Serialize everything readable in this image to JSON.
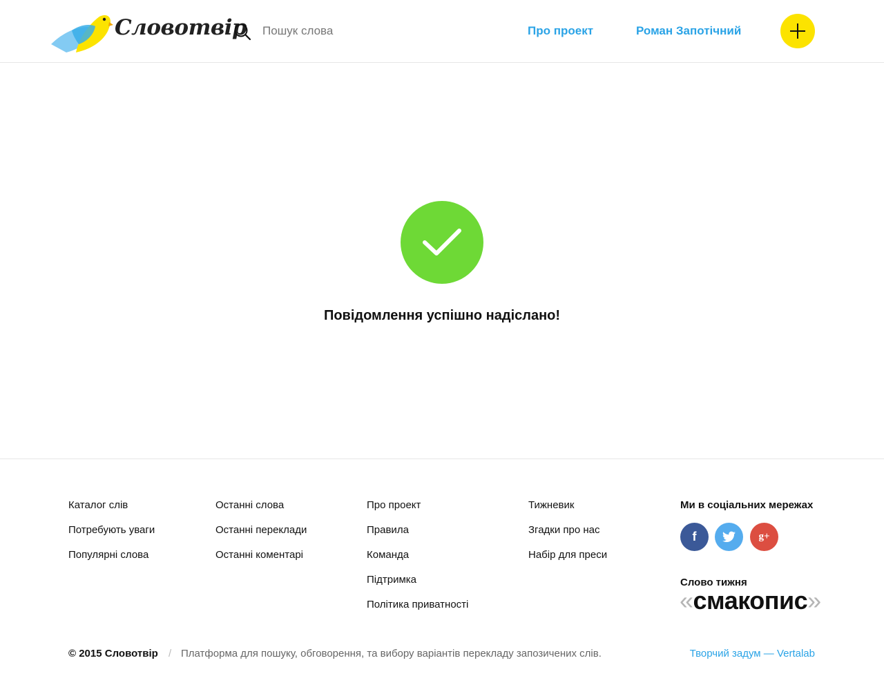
{
  "header": {
    "logo_text": "Словотвір",
    "search": {
      "placeholder": "Пошук слова",
      "value": "",
      "icon": "search-icon"
    },
    "nav": {
      "about": "Про проект",
      "user": "Роман Запотічний"
    },
    "add_button": {
      "icon": "plus-icon",
      "color": "#fce300"
    }
  },
  "main": {
    "success_icon": "checkmark-icon",
    "success_color": "#6ed936",
    "message": "Повідомлення успішно надіслано!"
  },
  "footer": {
    "col1": [
      "Каталог слів",
      "Потребують уваги",
      "Популярні слова"
    ],
    "col2": [
      "Останні слова",
      "Останні переклади",
      "Останні коментарі"
    ],
    "col3": [
      "Про проект",
      "Правила",
      "Команда",
      "Підтримка",
      "Політика приватності"
    ],
    "col4": [
      "Тижневик",
      "Згадки про нас",
      "Набір для преси"
    ],
    "social_title": "Ми в соціальних мережах",
    "social": [
      {
        "name": "facebook",
        "glyph": "f",
        "color": "#3b5998"
      },
      {
        "name": "twitter",
        "icon": "twitter-icon",
        "color": "#55acee"
      },
      {
        "name": "google-plus",
        "glyph": "g+",
        "color": "#dc4e41"
      }
    ],
    "word_of_week_label": "Слово тижня",
    "word_of_week": "смакопис",
    "quote_open": "«",
    "quote_close": "»",
    "copyright": "© 2015 Словотвір",
    "separator": "/",
    "tagline": "Платформа для пошуку, обговорення, та вибору варіантів перекладу запозичених слів.",
    "credits": "Творчий задум — Vertalab"
  },
  "colors": {
    "accent": "#2aa3e6",
    "border": "#e6e6e6"
  }
}
